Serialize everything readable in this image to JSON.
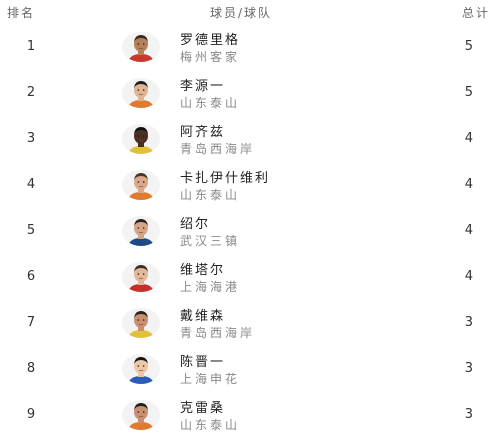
{
  "header": {
    "rank_label": "排名",
    "player_team_label": "球员/球队",
    "total_label": "总计"
  },
  "rows": [
    {
      "rank": "1",
      "name": "罗德里格",
      "team": "梅州客家",
      "total": "5",
      "skin": "#b5805a",
      "hair": "#3a2a22",
      "shirt": "#c8392e"
    },
    {
      "rank": "2",
      "name": "李源一",
      "team": "山东泰山",
      "total": "5",
      "skin": "#e0b592",
      "hair": "#1c1c1c",
      "shirt": "#e07a2e"
    },
    {
      "rank": "3",
      "name": "阿齐兹",
      "team": "青岛西海岸",
      "total": "4",
      "skin": "#4a2e22",
      "hair": "#111111",
      "shirt": "#e0c23a"
    },
    {
      "rank": "4",
      "name": "卡扎伊什维利",
      "team": "山东泰山",
      "total": "4",
      "skin": "#d9a98a",
      "hair": "#4a3528",
      "shirt": "#e07a2e"
    },
    {
      "rank": "5",
      "name": "绍尔",
      "team": "武汉三镇",
      "total": "4",
      "skin": "#d6a585",
      "hair": "#2a2420",
      "shirt": "#1f4a8a"
    },
    {
      "rank": "6",
      "name": "维塔尔",
      "team": "上海海港",
      "total": "4",
      "skin": "#e3b898",
      "hair": "#3a2e26",
      "shirt": "#c82e2e"
    },
    {
      "rank": "7",
      "name": "戴维森",
      "team": "青岛西海岸",
      "total": "3",
      "skin": "#c99070",
      "hair": "#2c2420",
      "shirt": "#e0c23a"
    },
    {
      "rank": "8",
      "name": "陈晋一",
      "team": "上海申花",
      "total": "3",
      "skin": "#ecc7a8",
      "hair": "#151515",
      "shirt": "#2a5cb8"
    },
    {
      "rank": "9",
      "name": "克雷桑",
      "team": "山东泰山",
      "total": "3",
      "skin": "#c89070",
      "hair": "#22201e",
      "shirt": "#e07a2e"
    }
  ]
}
